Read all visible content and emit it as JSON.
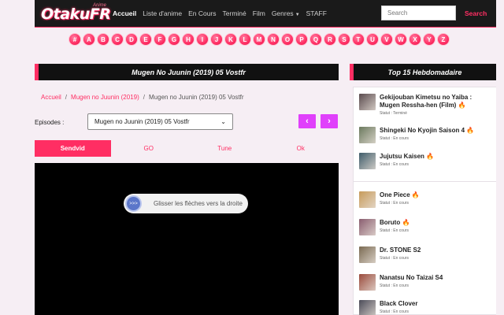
{
  "site": {
    "logo_main": "OtakuFR",
    "logo_sub": "Anime"
  },
  "nav": {
    "items": [
      "Accueil",
      "Liste d'anime",
      "En Cours",
      "Terminé",
      "Film",
      "Genres",
      "STAFF"
    ],
    "search_placeholder": "Search",
    "search_label": "Search"
  },
  "alphabet": [
    "#",
    "A",
    "B",
    "C",
    "D",
    "E",
    "F",
    "G",
    "H",
    "I",
    "J",
    "K",
    "L",
    "M",
    "N",
    "O",
    "P",
    "Q",
    "R",
    "S",
    "T",
    "U",
    "V",
    "W",
    "X",
    "Y",
    "Z"
  ],
  "main": {
    "title": "Mugen No Juunin (2019) 05 Vostfr",
    "breadcrumb": {
      "home": "Accueil",
      "series": "Mugen no Juunin (2019)",
      "current": "Mugen no Juunin (2019) 05 Vostfr"
    },
    "episodes_label": "Episodes :",
    "episode_selected": "Mugen no Juunin (2019) 05 Vostfr",
    "prev": "‹",
    "next": "›",
    "tabs": [
      "Sendvid",
      "GO",
      "Tune",
      "Ok"
    ],
    "swipe_text": "Glisser les flèches vers la droite",
    "swipe_knob": ">>>"
  },
  "sidebar": {
    "title": "Top 15 Hebdomadaire",
    "fire_icon": "🔥",
    "items": [
      {
        "title": "Gekijouban Kimetsu no Yaiba : Mugen Ressha-hen (Film)",
        "status": "Statut : Terminé",
        "hot": true,
        "color": "#5a4b4e"
      },
      {
        "title": "Shingeki No Kyojin Saison 4",
        "status": "Statut : En cours",
        "hot": true,
        "color": "#6b7a5e"
      },
      {
        "title": "Jujutsu Kaisen",
        "status": "Statut : En cours",
        "hot": true,
        "color": "#3f5c6a"
      },
      {
        "title": "One Piece",
        "status": "Statut : En cours",
        "hot": true,
        "color": "#c79b5a"
      },
      {
        "title": "Boruto",
        "status": "Statut : En cours",
        "hot": true,
        "color": "#8a5d6f"
      },
      {
        "title": "Dr. STONE S2",
        "status": "Statut : En cours",
        "hot": false,
        "color": "#7a6a52"
      },
      {
        "title": "Nanatsu No Taizai S4",
        "status": "Statut : En cours",
        "hot": false,
        "color": "#9a4a3c"
      },
      {
        "title": "Black Clover",
        "status": "Statut : En cours",
        "hot": false,
        "color": "#4b4b58"
      }
    ]
  }
}
